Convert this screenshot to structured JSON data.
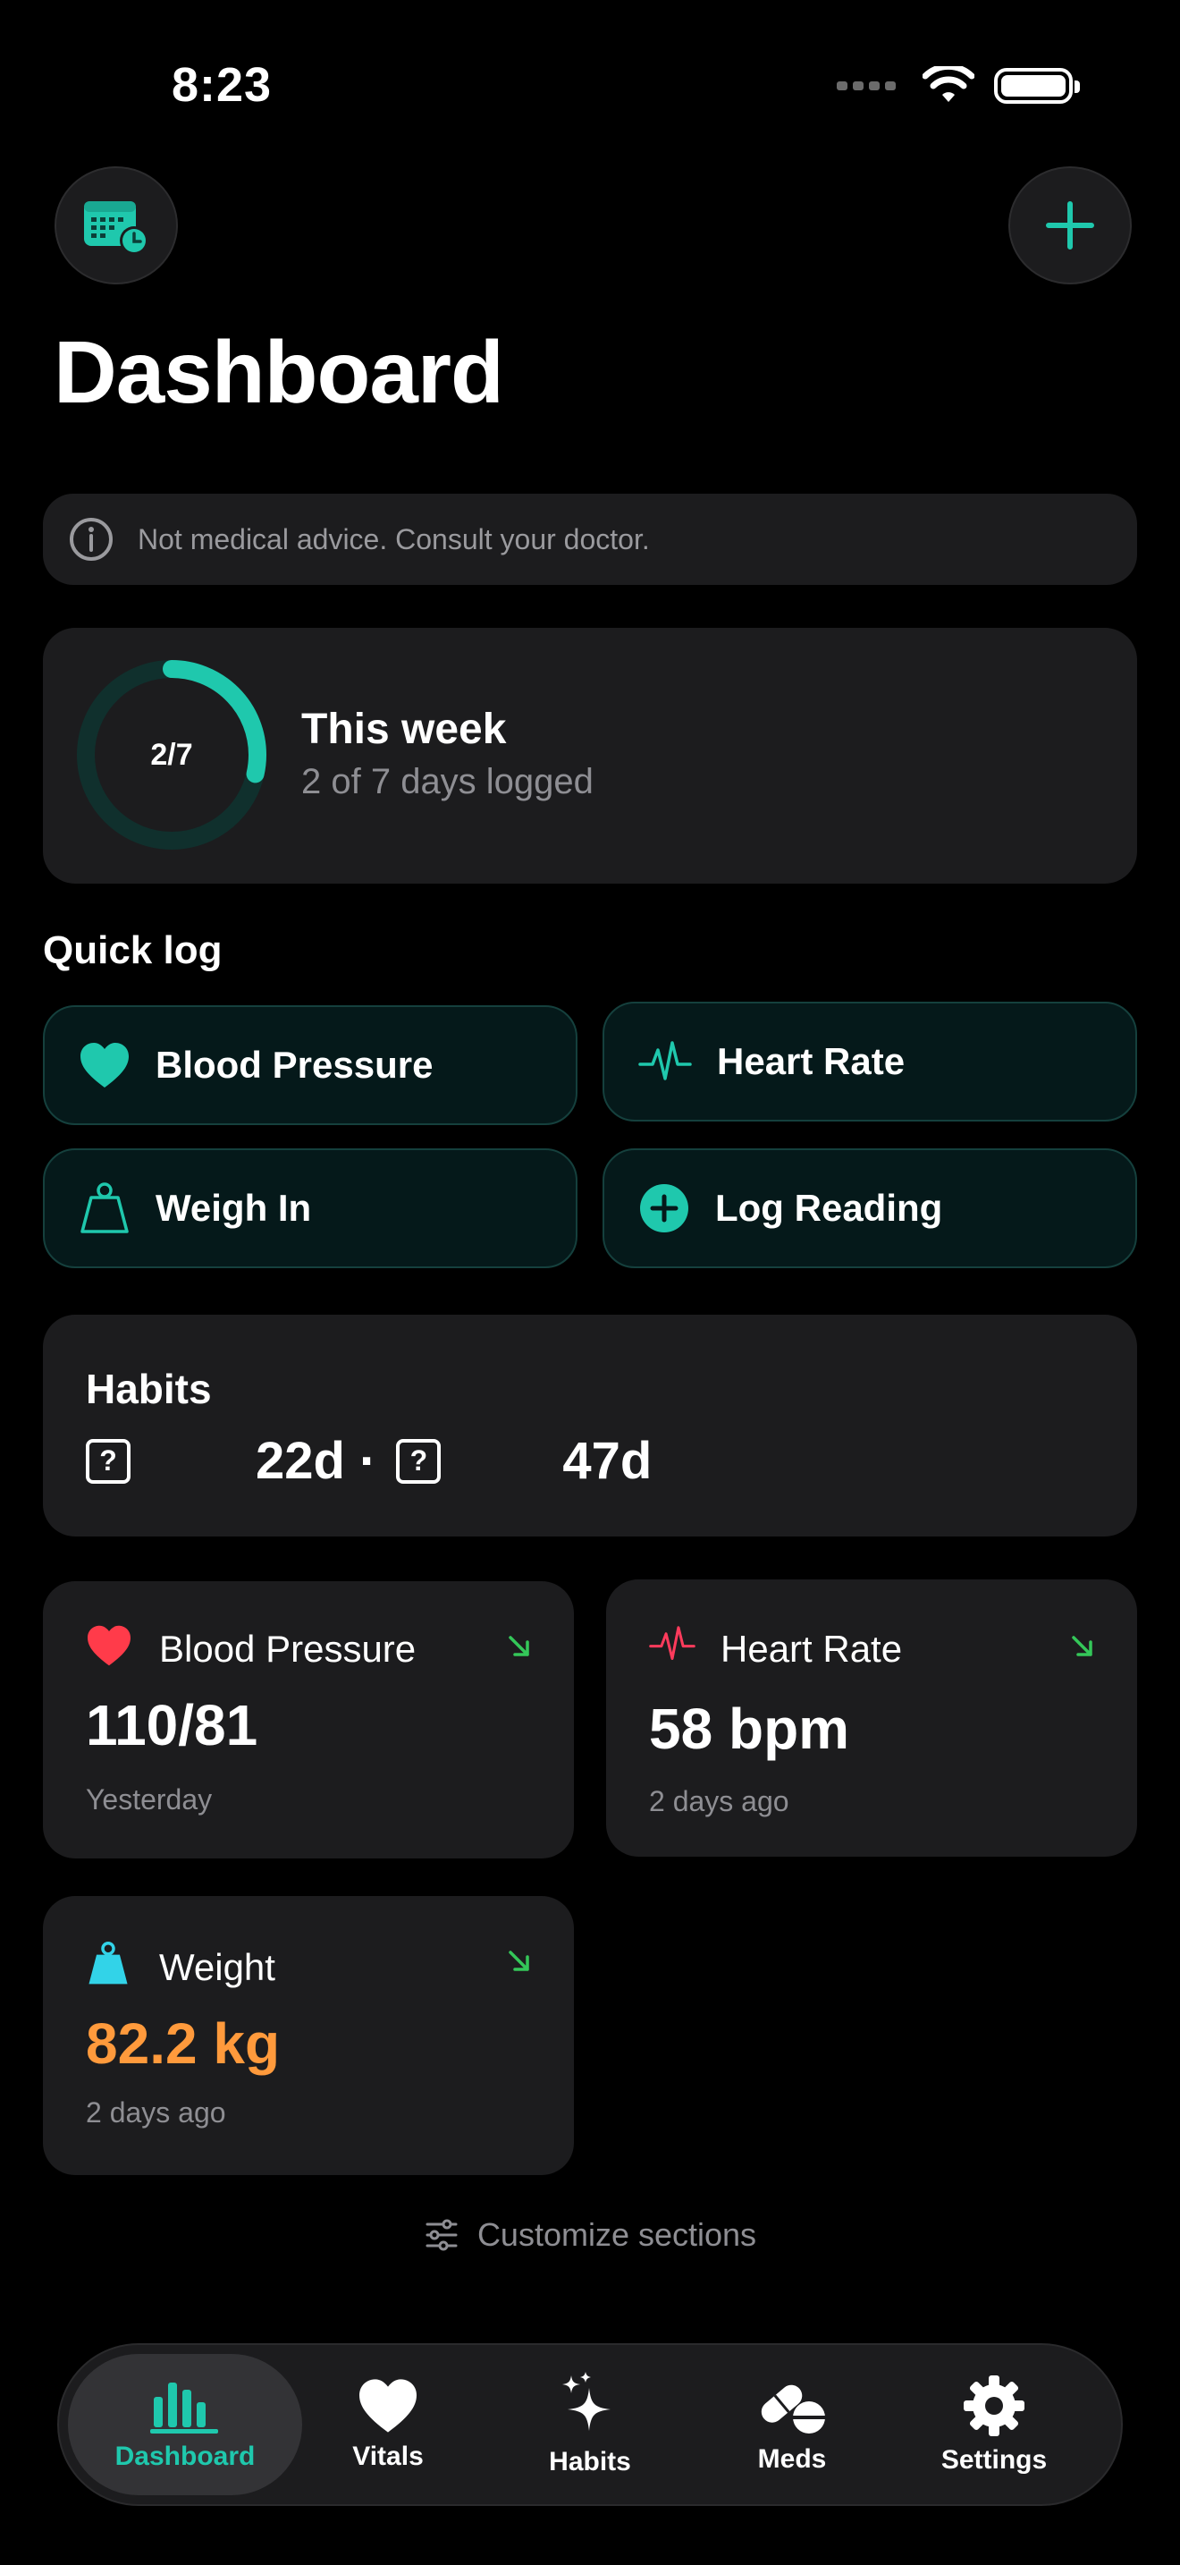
{
  "status_bar": {
    "time": "8:23"
  },
  "header": {
    "title": "Dashboard"
  },
  "notice": {
    "text": "Not medical advice. Consult your doctor."
  },
  "week": {
    "ring_label": "2/7",
    "title": "This week",
    "subtitle": "2 of 7 days logged",
    "progress": 0.2857
  },
  "quick_log": {
    "title": "Quick log",
    "items": [
      {
        "label": "Blood Pressure",
        "icon": "heart-icon"
      },
      {
        "label": "Heart Rate",
        "icon": "waveform-icon"
      },
      {
        "label": "Weigh In",
        "icon": "scale-icon"
      },
      {
        "label": "Log Reading",
        "icon": "plus-circle-icon"
      }
    ]
  },
  "habits": {
    "title": "Habits",
    "streak_1": "22d ·",
    "streak_2": "47d"
  },
  "metrics": [
    {
      "label": "Blood Pressure",
      "value": "110/81",
      "time": "Yesterday",
      "icon": "heart-icon",
      "value_color": "#ffffff",
      "trend": "down"
    },
    {
      "label": "Heart Rate",
      "value": "58 bpm",
      "time": "2 days ago",
      "icon": "waveform-icon",
      "value_color": "#ffffff",
      "trend": "down"
    },
    {
      "label": "Weight",
      "value": "82.2 kg",
      "time": "2 days ago",
      "icon": "scale-icon",
      "value_color": "#ff9a3c",
      "trend": "down"
    }
  ],
  "customize": {
    "label": "Customize sections"
  },
  "tabs": [
    {
      "label": "Dashboard",
      "icon": "chart-bars-icon",
      "active": true
    },
    {
      "label": "Vitals",
      "icon": "heart-icon"
    },
    {
      "label": "Habits",
      "icon": "sparkles-icon"
    },
    {
      "label": "Meds",
      "icon": "pills-icon"
    },
    {
      "label": "Settings",
      "icon": "gear-icon"
    }
  ],
  "colors": {
    "accent": "#1fc8ad",
    "background": "#000000",
    "card": "#1c1c1e",
    "heart_red": "#ff3b4a",
    "weight_orange": "#ff9a3c",
    "trend_green": "#34c759",
    "scale_cyan": "#32d3e8"
  }
}
